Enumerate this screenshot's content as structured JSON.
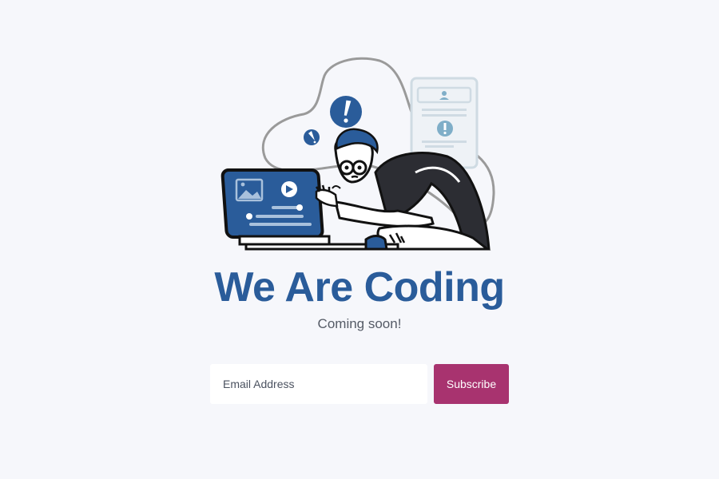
{
  "hero": {
    "title": "We Are Coding",
    "subtitle": "Coming soon!",
    "illustration_icon": "developer-at-laptop-illustration"
  },
  "subscribe": {
    "email_placeholder": "Email Address",
    "button_label": "Subscribe"
  },
  "colors": {
    "background": "#f6f7fb",
    "title": "#2a5c9a",
    "subtitle": "#555b66",
    "button": "#a8336f",
    "button_text": "#ffffff",
    "illustration_blue": "#2a5c9a",
    "illustration_dark": "#2c2d33"
  }
}
